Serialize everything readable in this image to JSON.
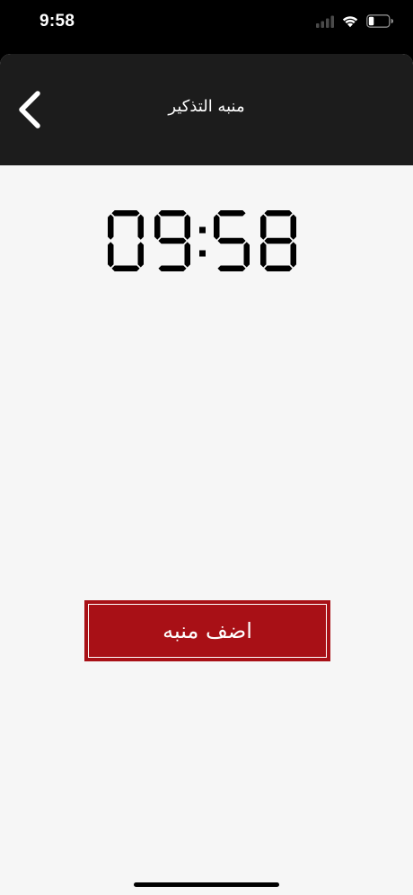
{
  "status_bar": {
    "time": "9:58",
    "icons": [
      "cellular-signal-icon",
      "wifi-icon",
      "battery-icon"
    ]
  },
  "nav": {
    "title": "منبه التذكير",
    "back_icon": "chevron-left-icon"
  },
  "clock": {
    "digits": [
      "0",
      "9",
      "5",
      "8"
    ],
    "separator": ":"
  },
  "add_alarm": {
    "label": "اضف منبه"
  },
  "colors": {
    "status_bg": "#000000",
    "nav_bg": "#1c1c1c",
    "content_bg": "#f6f6f6",
    "accent": "#a81016",
    "text_light": "#ffffff",
    "clock_digits": "#000000"
  }
}
